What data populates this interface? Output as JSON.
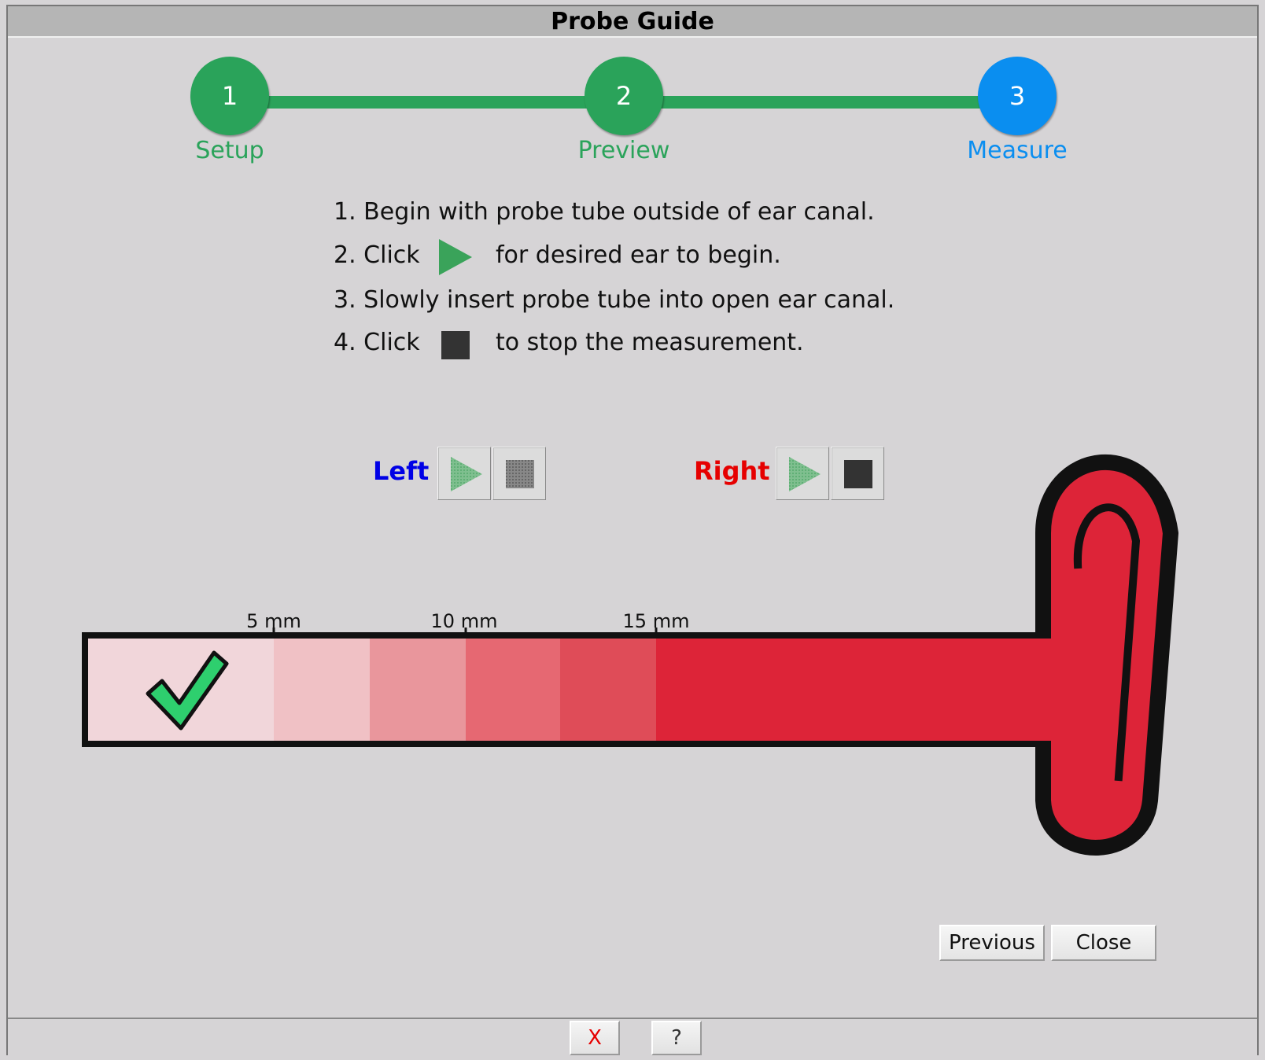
{
  "window": {
    "title": "Probe Guide"
  },
  "steps": [
    {
      "number": "1",
      "label": "Setup",
      "color": "#2aa35a",
      "state": "complete"
    },
    {
      "number": "2",
      "label": "Preview",
      "color": "#2aa35a",
      "state": "complete"
    },
    {
      "number": "3",
      "label": "Measure",
      "color": "#0a8ef0",
      "state": "active"
    }
  ],
  "instructions": {
    "line1": "1. Begin with probe tube outside of ear canal.",
    "line2_pre": "2. Click",
    "line2_icon": "play-icon",
    "line2_post": "for desired ear to begin.",
    "line3": "3. Slowly insert probe tube into open ear canal.",
    "line4_pre": "4. Click",
    "line4_icon": "stop-icon",
    "line4_post": "to stop the measurement."
  },
  "controls": {
    "left": {
      "label": "Left",
      "color": "#0000e6",
      "play_icon": "play-icon",
      "stop_icon": "stop-icon"
    },
    "right": {
      "label": "Right",
      "color": "#e60000",
      "play_icon": "play-icon",
      "stop_icon": "stop-icon"
    }
  },
  "ruler": {
    "ticks": [
      "5 mm",
      "10 mm",
      "15 mm"
    ],
    "status_icon": "checkmark-icon",
    "segment_colors": [
      "#f1d6da",
      "#f0c1c5",
      "#e9969c",
      "#e66872",
      "#df4c58",
      "#dd2438"
    ]
  },
  "buttons": {
    "previous": "Previous",
    "close": "Close"
  },
  "statusbar": {
    "close_glyph": "X",
    "help_glyph": "?"
  }
}
